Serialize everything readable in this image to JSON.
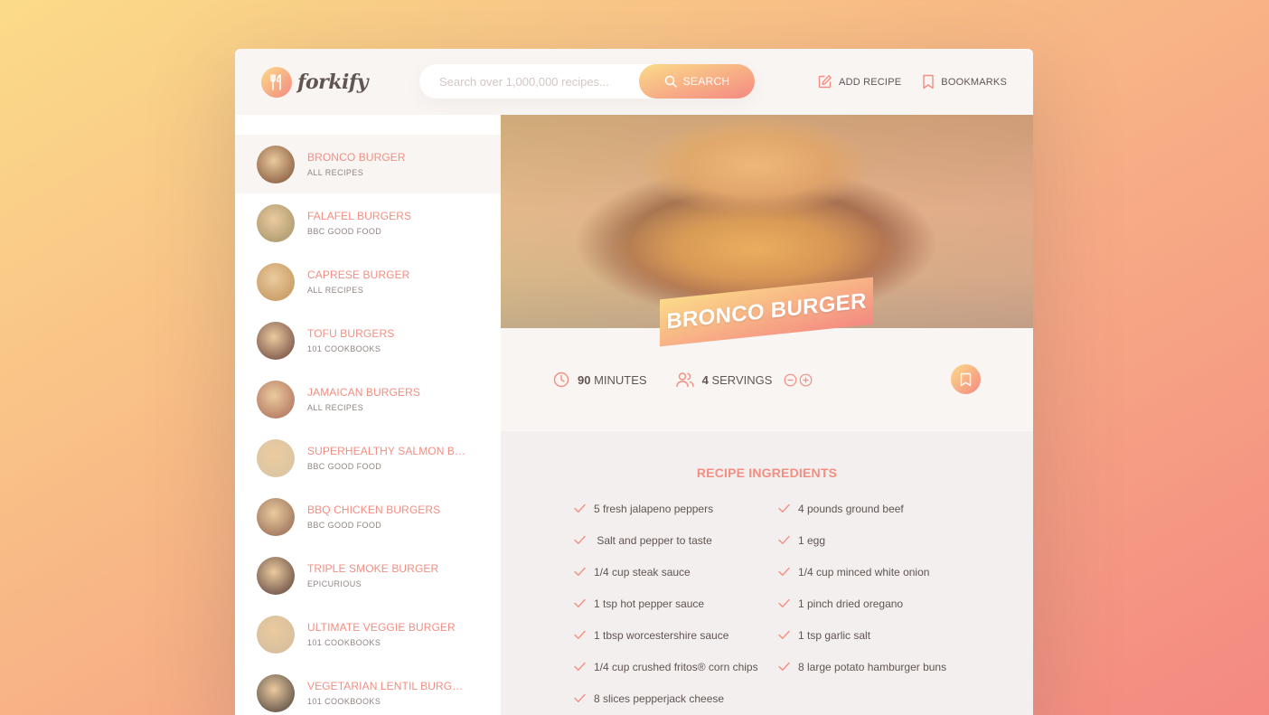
{
  "header": {
    "logo_text": "forkify",
    "search": {
      "placeholder": "Search over 1,000,000 recipes...",
      "button_label": "SEARCH"
    },
    "nav": {
      "add_recipe_label": "ADD RECIPE",
      "bookmarks_label": "BOOKMARKS"
    }
  },
  "results": [
    {
      "title": "BRONCO BURGER",
      "publisher": "ALL RECIPES",
      "active": true,
      "thumb_color": "#8a5a36"
    },
    {
      "title": "FALAFEL BURGERS",
      "publisher": "BBC GOOD FOOD",
      "active": false,
      "thumb_color": "#a8915e"
    },
    {
      "title": "CAPRESE BURGER",
      "publisher": "ALL RECIPES",
      "active": false,
      "thumb_color": "#c49152"
    },
    {
      "title": "TOFU BURGERS",
      "publisher": "101 COOKBOOKS",
      "active": false,
      "thumb_color": "#7a4d3a"
    },
    {
      "title": "JAMAICAN BURGERS",
      "publisher": "ALL RECIPES",
      "active": false,
      "thumb_color": "#b06f52"
    },
    {
      "title": "SUPERHEALTHY SALMON BURGER",
      "publisher": "BBC GOOD FOOD",
      "active": false,
      "thumb_color": "#d7bc93"
    },
    {
      "title": "BBQ CHICKEN BURGERS",
      "publisher": "BBC GOOD FOOD",
      "active": false,
      "thumb_color": "#9a6b4b"
    },
    {
      "title": "TRIPLE SMOKE BURGER",
      "publisher": "EPICURIOUS",
      "active": false,
      "thumb_color": "#6b4a38"
    },
    {
      "title": "ULTIMATE VEGGIE BURGER",
      "publisher": "101 COOKBOOKS",
      "active": false,
      "thumb_color": "#d2b48c"
    },
    {
      "title": "VEGETARIAN LENTIL BURGERS",
      "publisher": "101 COOKBOOKS",
      "active": false,
      "thumb_color": "#5e4a38"
    }
  ],
  "recipe": {
    "title": "BRONCO BURGER",
    "cooking_time": "90",
    "cooking_time_unit": "MINUTES",
    "servings": "4",
    "servings_unit": "SERVINGS",
    "ingredients_heading": "RECIPE INGREDIENTS",
    "ingredients": [
      "5 fresh jalapeno peppers",
      "4 pounds ground beef",
      " Salt and pepper to taste",
      "1 egg",
      "1/4 cup steak sauce",
      "1/4 cup minced white onion",
      "1 tsp hot pepper sauce",
      "1 pinch dried oregano",
      "1 tbsp worcestershire sauce",
      "1 tsp garlic salt",
      "1/4 cup crushed fritos® corn chips",
      "8 large potato hamburger buns",
      "8 slices pepperjack cheese"
    ]
  },
  "colors": {
    "accent": "#f38e82",
    "gradient_start": "#fbdb89",
    "gradient_end": "#f48982",
    "text": "#615551"
  }
}
